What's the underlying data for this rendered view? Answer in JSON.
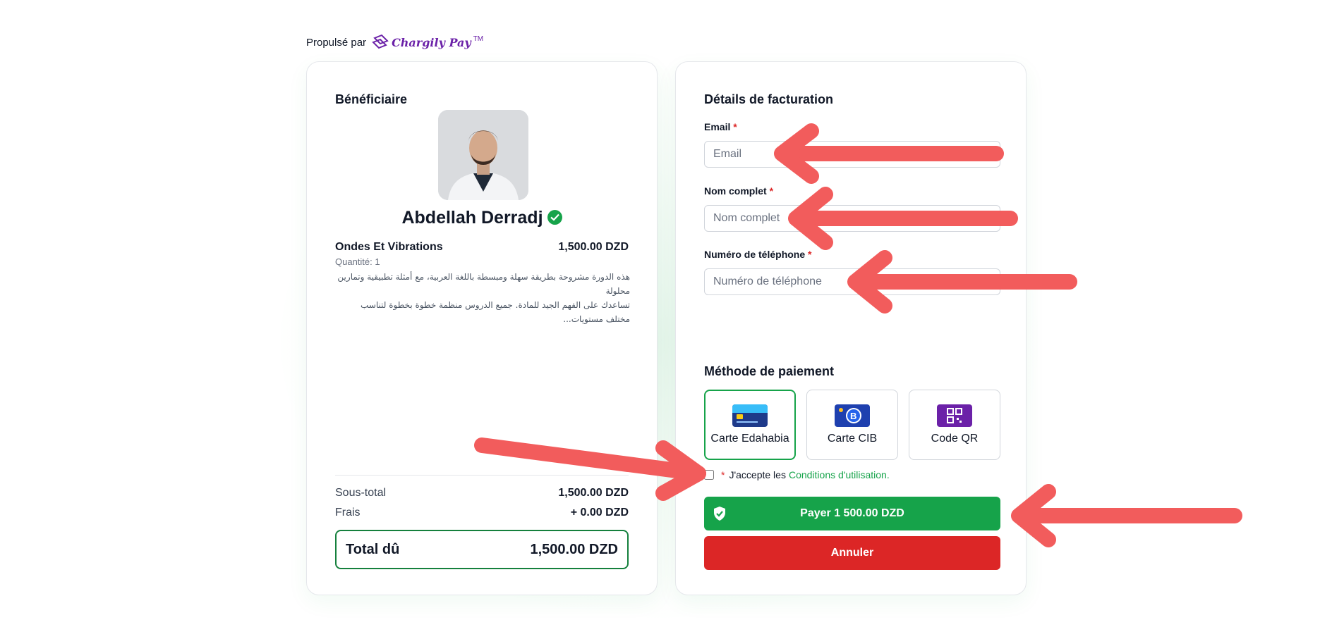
{
  "powered": {
    "prefix": "Propulsé par",
    "brand": "Chargily Pay",
    "tm": "TM"
  },
  "colors": {
    "accent": "#16a34a",
    "danger": "#dc2626",
    "brand": "#6b21a8",
    "annotation_arrow": "#f25c5c"
  },
  "beneficiary": {
    "heading": "Bénéficiaire",
    "name": "Abdellah Derradj",
    "verified_icon": "verified-check-icon"
  },
  "item": {
    "name": "Ondes Et Vibrations",
    "price": "1,500.00 DZD",
    "quantity": "Quantité: 1",
    "description_line1": "هذه الدورة مشروحة بطريقة سهلة ومبسطة باللغة العربية، مع أمثلة تطبيقية وتمارين محلولة",
    "description_line2": "تساعدك على الفهم الجيد للمادة. جميع الدروس منظمة خطوة بخطوة لتناسب مختلف مستويات..."
  },
  "summary": {
    "subtotal_label": "Sous-total",
    "subtotal_value": "1,500.00 DZD",
    "fees_label": "Frais",
    "fees_value": "+ 0.00 DZD",
    "total_label": "Total dû",
    "total_value": "1,500.00 DZD"
  },
  "billing": {
    "heading": "Détails de facturation",
    "email_label": "Email",
    "email_placeholder": "Email",
    "fullname_label": "Nom complet",
    "fullname_placeholder": "Nom complet",
    "phone_label": "Numéro de téléphone",
    "phone_placeholder": "Numéro de téléphone",
    "required_mark": "*"
  },
  "payment": {
    "heading": "Méthode de paiement",
    "methods": [
      {
        "label": "Carte Edahabia",
        "icon": "edahabia-card-icon",
        "selected": true
      },
      {
        "label": "Carte CIB",
        "icon": "cib-card-icon",
        "selected": false
      },
      {
        "label": "Code QR",
        "icon": "qr-code-icon",
        "selected": false
      }
    ]
  },
  "terms": {
    "required_mark": "*",
    "text": "J'accepte les",
    "link": "Conditions d'utilisation."
  },
  "actions": {
    "pay_label": "Payer 1 500.00 DZD",
    "cancel_label": "Annuler"
  }
}
